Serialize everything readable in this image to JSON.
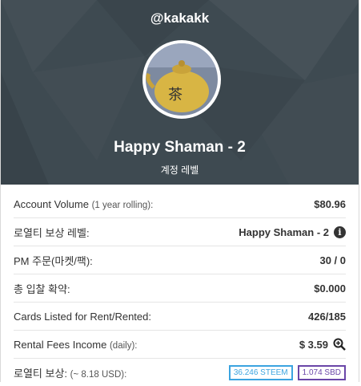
{
  "profile": {
    "username": "@kakakk",
    "level_name": "Happy Shaman - 2",
    "level_label": "계정 레벨"
  },
  "stats": [
    {
      "label": "Account Volume",
      "sub": "(1 year rolling):",
      "value": "$80.96"
    },
    {
      "label": "로열티 보상 레벨:",
      "sub": "",
      "value": "Happy Shaman - 2",
      "icon": "info-icon"
    },
    {
      "label": "PM 주문(마켓/팩):",
      "sub": "",
      "value": "30 / 0"
    },
    {
      "label": "총 입찰 확약:",
      "sub": "",
      "value": "$0.000"
    },
    {
      "label": "Cards Listed for Rent/Rented:",
      "sub": "",
      "value": "426/185"
    },
    {
      "label": "Rental Fees Income",
      "sub": "(daily):",
      "value": "$ 3.59",
      "icon": "zoom-in-icon"
    },
    {
      "label": "로열티 보상:",
      "sub": "(~ 8.18 USD):",
      "steem": "36.246 STEEM",
      "sbd": "1.074 SBD"
    }
  ],
  "colors": {
    "header_bg": "#3e4a51",
    "steem_badge": "#3ba4e0",
    "sbd_badge": "#6a46a8"
  }
}
